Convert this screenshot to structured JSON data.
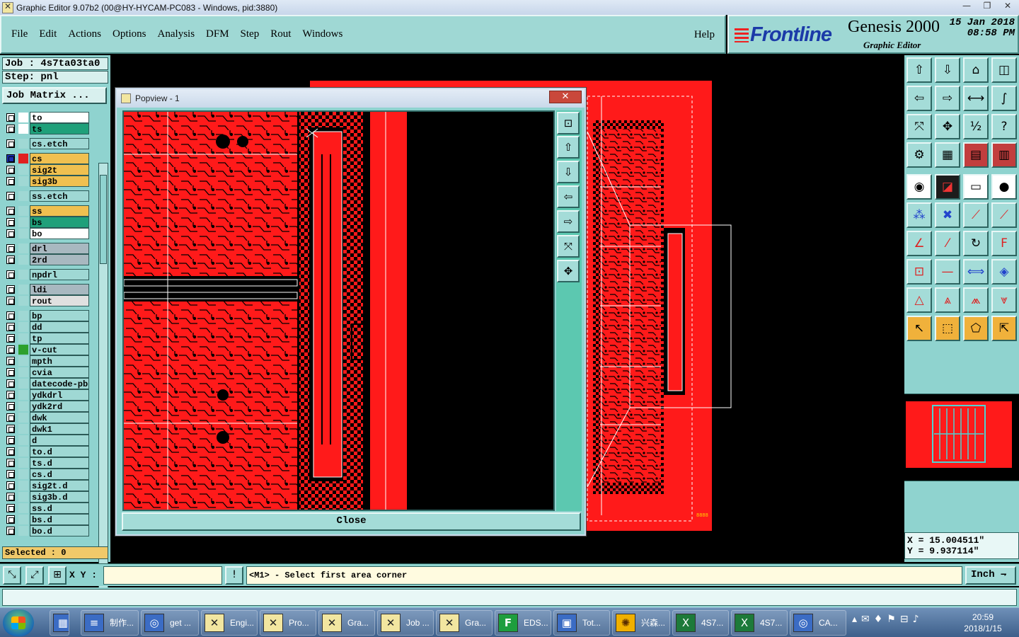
{
  "window": {
    "title": "Graphic Editor 9.07b2 (00@HY-HYCAM-PC083 - Windows, pid:3880)",
    "minimize": "—",
    "maximize": "❐",
    "close": "✕"
  },
  "menu": {
    "items": [
      "File",
      "Edit",
      "Actions",
      "Options",
      "Analysis",
      "DFM",
      "Step",
      "Rout",
      "Windows"
    ],
    "help": "Help"
  },
  "brand": {
    "logo": "Frontline",
    "product": "Genesis 2000",
    "subtitle": "Graphic Editor",
    "date": "15 Jan 2018",
    "time": "08:58 PM"
  },
  "left": {
    "job": "Job : 4s7ta03ta0",
    "step": "Step: pnl",
    "job_matrix": "Job Matrix ...",
    "layers": [
      {
        "name": "to",
        "color": "#ffffff",
        "swatch": "#ffffff"
      },
      {
        "name": "ts",
        "color": "#1fa07a",
        "swatch": "#ffffff"
      },
      {
        "name": "cs.etch",
        "color": "#9fd8d4",
        "swatch": "#9fd8d4"
      },
      {
        "name": "cs",
        "color": "#f0c050",
        "swatch": "#e02020",
        "active": true
      },
      {
        "name": "sig2t",
        "color": "#f0c050",
        "swatch": "#9fd8d4"
      },
      {
        "name": "sig3b",
        "color": "#f0c050",
        "swatch": "#9fd8d4"
      },
      {
        "name": "ss.etch",
        "color": "#9fd8d4",
        "swatch": "#9fd8d4"
      },
      {
        "name": "ss",
        "color": "#f0c050",
        "swatch": "#9fd8d4"
      },
      {
        "name": "bs",
        "color": "#1fa07a",
        "swatch": "#9fd8d4"
      },
      {
        "name": "bo",
        "color": "#ffffff",
        "swatch": "#9fd8d4"
      },
      {
        "name": "drl",
        "color": "#a8b8c0",
        "swatch": "#9fd8d4"
      },
      {
        "name": "2rd",
        "color": "#a8b8c0",
        "swatch": "#9fd8d4"
      },
      {
        "name": "npdrl",
        "color": "#9fd8d4",
        "swatch": "#9fd8d4"
      },
      {
        "name": "ldi",
        "color": "#a8b8c0",
        "swatch": "#9fd8d4"
      },
      {
        "name": "rout",
        "color": "#e0e0e0",
        "swatch": "#9fd8d4"
      },
      {
        "name": "bp",
        "color": "#9fd8d4",
        "swatch": "#9fd8d4"
      },
      {
        "name": "dd",
        "color": "#9fd8d4",
        "swatch": "#9fd8d4"
      },
      {
        "name": "tp",
        "color": "#9fd8d4",
        "swatch": "#9fd8d4"
      },
      {
        "name": "v-cut",
        "color": "#9fd8d4",
        "swatch": "#2da02d"
      },
      {
        "name": "mpth",
        "color": "#9fd8d4",
        "swatch": "#9fd8d4"
      },
      {
        "name": "cvia",
        "color": "#9fd8d4",
        "swatch": "#9fd8d4"
      },
      {
        "name": "datecode-pbc",
        "color": "#9fd8d4",
        "swatch": "#9fd8d4"
      },
      {
        "name": "ydkdrl",
        "color": "#9fd8d4",
        "swatch": "#9fd8d4"
      },
      {
        "name": "ydk2rd",
        "color": "#9fd8d4",
        "swatch": "#9fd8d4"
      },
      {
        "name": "dwk",
        "color": "#9fd8d4",
        "swatch": "#9fd8d4"
      },
      {
        "name": "dwk1",
        "color": "#9fd8d4",
        "swatch": "#9fd8d4"
      },
      {
        "name": "d",
        "color": "#9fd8d4",
        "swatch": "#9fd8d4"
      },
      {
        "name": "to.d",
        "color": "#9fd8d4",
        "swatch": "#9fd8d4"
      },
      {
        "name": "ts.d",
        "color": "#9fd8d4",
        "swatch": "#9fd8d4"
      },
      {
        "name": "cs.d",
        "color": "#9fd8d4",
        "swatch": "#9fd8d4"
      },
      {
        "name": "sig2t.d",
        "color": "#9fd8d4",
        "swatch": "#9fd8d4"
      },
      {
        "name": "sig3b.d",
        "color": "#9fd8d4",
        "swatch": "#9fd8d4"
      },
      {
        "name": "ss.d",
        "color": "#9fd8d4",
        "swatch": "#9fd8d4"
      },
      {
        "name": "bs.d",
        "color": "#9fd8d4",
        "swatch": "#9fd8d4"
      },
      {
        "name": "bo.d",
        "color": "#9fd8d4",
        "swatch": "#9fd8d4"
      }
    ],
    "selected": "Selected : 0"
  },
  "popview": {
    "title": "Popview - 1",
    "close_x": "✕",
    "close_button": "Close"
  },
  "coords": {
    "x": "X = 15.004511\"",
    "y": "Y = 9.937114\""
  },
  "command": {
    "xy_label": "X Y :",
    "xy_value": "",
    "alert_icon": "!",
    "prompt": "<M1> - Select first area corner",
    "unit": "Inch ⇁"
  },
  "taskbar": {
    "tasks": [
      "制作...",
      "get ...",
      "Engi...",
      "Pro...",
      "Gra...",
      "Job ...",
      "Gra...",
      "EDS...",
      "Tot...",
      "兴森...",
      "4S7...",
      "4S7...",
      "CA..."
    ],
    "time": "20:59",
    "date": "2018/1/15"
  },
  "colors": {
    "panel": "#8fd3cf",
    "copper": "#ff1a1a",
    "accent": "#f0c050"
  }
}
